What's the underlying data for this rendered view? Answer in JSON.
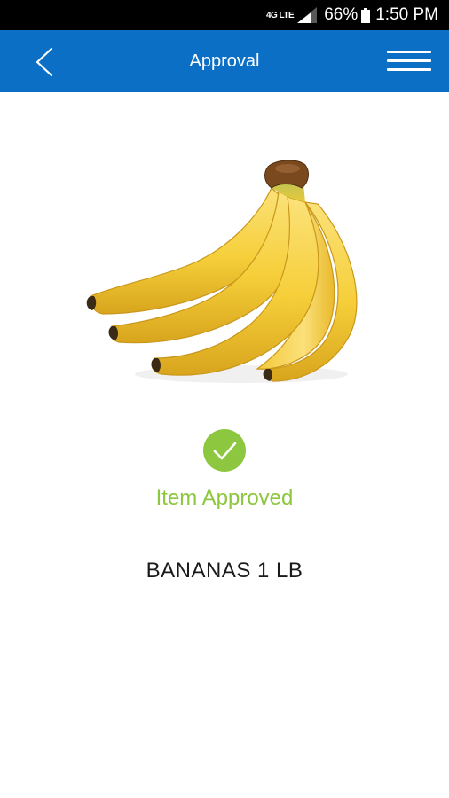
{
  "status_bar": {
    "network": "4G LTE",
    "battery": "66%",
    "time": "1:50 PM",
    "icons": [
      "signal-icon",
      "battery-icon"
    ]
  },
  "header": {
    "title": "Approval",
    "background_color": "#0b6fc6",
    "back_icon": "chevron-left-icon",
    "menu_icon": "hamburger-menu-icon"
  },
  "item": {
    "image": "banana-bunch",
    "approval_text": "Item Approved",
    "approval_color": "#8dc63f",
    "approval_icon": "check-circle-icon",
    "name": "BANANAS 1 LB"
  }
}
